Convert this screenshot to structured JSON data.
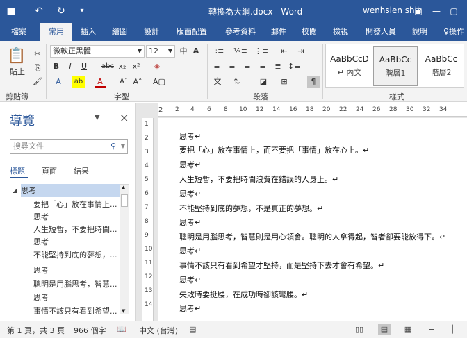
{
  "window": {
    "title": "轉換為大綱.docx - Word",
    "user": "wenhsien shih"
  },
  "tabs": [
    "檔案",
    "常用",
    "插入",
    "繪圖",
    "設計",
    "版面配置",
    "參考資料",
    "郵件",
    "校閱",
    "檢視",
    "開發人員",
    "說明",
    "操作"
  ],
  "ribbon": {
    "paste_label": "貼上",
    "clipboard_label": "剪貼簿",
    "font_label": "字型",
    "paragraph_label": "段落",
    "styles_label": "樣式",
    "font_name": "微軟正黑體",
    "font_size": "12",
    "phonetic": "中",
    "char_a": "A",
    "bold": "B",
    "italic": "I",
    "underline": "U",
    "strike": "abc",
    "subscript": "x₂",
    "superscript": "x²",
    "styles": [
      {
        "sample": "AaBbCcD",
        "name": "↵ 內文"
      },
      {
        "sample": "AaBbCc",
        "name": "階層1"
      },
      {
        "sample": "AaBbCc",
        "name": "階層2"
      }
    ]
  },
  "nav": {
    "title": "導覽",
    "search_placeholder": "搜尋文件",
    "tabs": [
      "標題",
      "頁面",
      "結果"
    ],
    "items": [
      {
        "text": "思考",
        "level": 1
      },
      {
        "text": "要把「心」放在事情上...",
        "level": 2
      },
      {
        "text": "思考",
        "level": 2
      },
      {
        "text": "人生短暫，不要把時間...",
        "level": 2
      },
      {
        "text": "思考",
        "level": 2
      },
      {
        "text": "不能堅持到底的夢想，...",
        "level": 2
      },
      {
        "text": "思考",
        "level": 2
      },
      {
        "text": "聰明是用腦思考，智慧...",
        "level": 2
      },
      {
        "text": "思考",
        "level": 2
      },
      {
        "text": "事情不該只有看到希望...",
        "level": 2
      }
    ]
  },
  "ruler": {
    "h": [
      "2",
      "2",
      "4",
      "6",
      "8",
      "10",
      "12",
      "14",
      "16",
      "18",
      "20",
      "22",
      "24",
      "26",
      "28",
      "30",
      "32",
      "34"
    ],
    "v": [
      "1",
      "2",
      "3",
      "4",
      "5",
      "6",
      "7",
      "8",
      "9",
      "10",
      "11",
      "12",
      "13",
      "14"
    ]
  },
  "document": {
    "paragraphs": [
      "思考↵",
      "要把「心」放在事情上，而不要把「事情」放在心上。↵",
      "思考↵",
      "人生短暫，不要把時間浪費在錯誤的人身上。↵",
      "思考↵",
      "不能堅持到底的夢想，不是真正的夢想。↵",
      "思考↵",
      "聰明是用腦思考，智慧則是用心領會。聰明的人拿得起，智者卻要能放得下。↵",
      "思考↵",
      "事情不該只有看到希望才堅持，而是堅持下去才會有希望。↵",
      "思考↵",
      "失敗時要挺腰，在成功時卻該彎腰。↵",
      "思考↵"
    ]
  },
  "status": {
    "page": "第 1 頁，共 3 頁",
    "words": "966 個字",
    "lang": "中文 (台灣)"
  }
}
